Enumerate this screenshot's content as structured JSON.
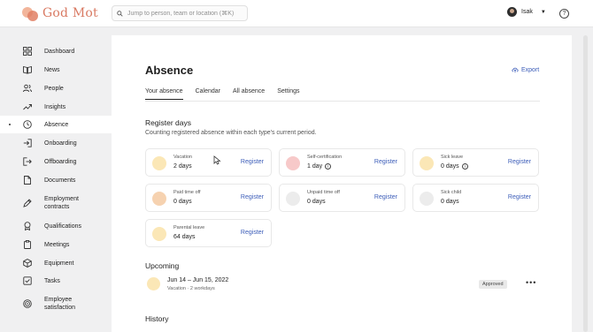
{
  "app": {
    "logo_text": "God Mot"
  },
  "search": {
    "placeholder": "Jump to person, team or location (⌘K)"
  },
  "user": {
    "name": "Isak"
  },
  "help": {
    "label": "?"
  },
  "sidebar": {
    "items": [
      {
        "label": "Dashboard",
        "icon": "grid-icon"
      },
      {
        "label": "News",
        "icon": "book-icon"
      },
      {
        "label": "People",
        "icon": "people-icon"
      },
      {
        "label": "Insights",
        "icon": "trend-icon"
      },
      {
        "label": "Absence",
        "icon": "clock-icon",
        "active": true
      },
      {
        "label": "Onboarding",
        "icon": "login-icon"
      },
      {
        "label": "Offboarding",
        "icon": "logout-icon"
      },
      {
        "label": "Documents",
        "icon": "document-icon"
      },
      {
        "label": "Employment contracts",
        "icon": "pen-icon"
      },
      {
        "label": "Qualifications",
        "icon": "award-icon"
      },
      {
        "label": "Meetings",
        "icon": "clipboard-icon"
      },
      {
        "label": "Equipment",
        "icon": "box-icon"
      },
      {
        "label": "Tasks",
        "icon": "checkbox-icon"
      },
      {
        "label": "Employee satisfaction",
        "icon": "target-icon"
      }
    ]
  },
  "page": {
    "title": "Absence",
    "export_label": "Export",
    "tabs": [
      "Your absence",
      "Calendar",
      "All absence",
      "Settings"
    ],
    "register": {
      "title": "Register days",
      "subtitle": "Counting registered absence within each type's current period.",
      "cards": [
        {
          "type": "Vacation",
          "value": "2 days",
          "color": "#fbe7b6",
          "info": false
        },
        {
          "type": "Self-certification",
          "value": "1 day",
          "color": "#f7c9c9",
          "info": true
        },
        {
          "type": "Sick leave",
          "value": "0 days",
          "color": "#fbe7b6",
          "info": true
        },
        {
          "type": "Paid time off",
          "value": "0 days",
          "color": "#f6d2b0",
          "info": false
        },
        {
          "type": "Unpaid time off",
          "value": "0 days",
          "color": "#ececec",
          "info": false
        },
        {
          "type": "Sick child",
          "value": "0 days",
          "color": "#ececec",
          "info": false
        },
        {
          "type": "Parental leave",
          "value": "64 days",
          "color": "#fbe7b6",
          "info": false
        }
      ],
      "register_label": "Register"
    },
    "upcoming": {
      "title": "Upcoming",
      "item": {
        "date": "Jun 14 – Jun 15, 2022",
        "meta": "Vacation · 2 workdays",
        "status": "Approved"
      }
    },
    "history": {
      "title": "History"
    }
  }
}
